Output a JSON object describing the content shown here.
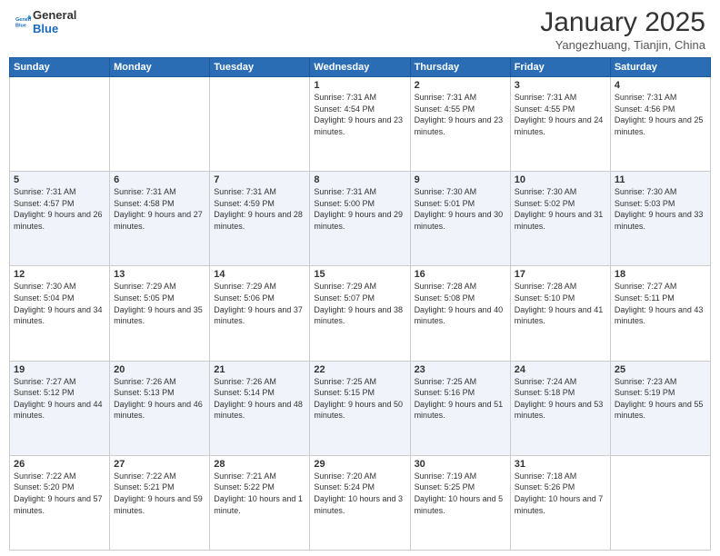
{
  "header": {
    "logo_line1": "General",
    "logo_line2": "Blue",
    "month_title": "January 2025",
    "location": "Yangezhuang, Tianjin, China"
  },
  "weekdays": [
    "Sunday",
    "Monday",
    "Tuesday",
    "Wednesday",
    "Thursday",
    "Friday",
    "Saturday"
  ],
  "weeks": [
    [
      {
        "day": "",
        "info": ""
      },
      {
        "day": "",
        "info": ""
      },
      {
        "day": "",
        "info": ""
      },
      {
        "day": "1",
        "info": "Sunrise: 7:31 AM\nSunset: 4:54 PM\nDaylight: 9 hours and 23 minutes."
      },
      {
        "day": "2",
        "info": "Sunrise: 7:31 AM\nSunset: 4:55 PM\nDaylight: 9 hours and 23 minutes."
      },
      {
        "day": "3",
        "info": "Sunrise: 7:31 AM\nSunset: 4:55 PM\nDaylight: 9 hours and 24 minutes."
      },
      {
        "day": "4",
        "info": "Sunrise: 7:31 AM\nSunset: 4:56 PM\nDaylight: 9 hours and 25 minutes."
      }
    ],
    [
      {
        "day": "5",
        "info": "Sunrise: 7:31 AM\nSunset: 4:57 PM\nDaylight: 9 hours and 26 minutes."
      },
      {
        "day": "6",
        "info": "Sunrise: 7:31 AM\nSunset: 4:58 PM\nDaylight: 9 hours and 27 minutes."
      },
      {
        "day": "7",
        "info": "Sunrise: 7:31 AM\nSunset: 4:59 PM\nDaylight: 9 hours and 28 minutes."
      },
      {
        "day": "8",
        "info": "Sunrise: 7:31 AM\nSunset: 5:00 PM\nDaylight: 9 hours and 29 minutes."
      },
      {
        "day": "9",
        "info": "Sunrise: 7:30 AM\nSunset: 5:01 PM\nDaylight: 9 hours and 30 minutes."
      },
      {
        "day": "10",
        "info": "Sunrise: 7:30 AM\nSunset: 5:02 PM\nDaylight: 9 hours and 31 minutes."
      },
      {
        "day": "11",
        "info": "Sunrise: 7:30 AM\nSunset: 5:03 PM\nDaylight: 9 hours and 33 minutes."
      }
    ],
    [
      {
        "day": "12",
        "info": "Sunrise: 7:30 AM\nSunset: 5:04 PM\nDaylight: 9 hours and 34 minutes."
      },
      {
        "day": "13",
        "info": "Sunrise: 7:29 AM\nSunset: 5:05 PM\nDaylight: 9 hours and 35 minutes."
      },
      {
        "day": "14",
        "info": "Sunrise: 7:29 AM\nSunset: 5:06 PM\nDaylight: 9 hours and 37 minutes."
      },
      {
        "day": "15",
        "info": "Sunrise: 7:29 AM\nSunset: 5:07 PM\nDaylight: 9 hours and 38 minutes."
      },
      {
        "day": "16",
        "info": "Sunrise: 7:28 AM\nSunset: 5:08 PM\nDaylight: 9 hours and 40 minutes."
      },
      {
        "day": "17",
        "info": "Sunrise: 7:28 AM\nSunset: 5:10 PM\nDaylight: 9 hours and 41 minutes."
      },
      {
        "day": "18",
        "info": "Sunrise: 7:27 AM\nSunset: 5:11 PM\nDaylight: 9 hours and 43 minutes."
      }
    ],
    [
      {
        "day": "19",
        "info": "Sunrise: 7:27 AM\nSunset: 5:12 PM\nDaylight: 9 hours and 44 minutes."
      },
      {
        "day": "20",
        "info": "Sunrise: 7:26 AM\nSunset: 5:13 PM\nDaylight: 9 hours and 46 minutes."
      },
      {
        "day": "21",
        "info": "Sunrise: 7:26 AM\nSunset: 5:14 PM\nDaylight: 9 hours and 48 minutes."
      },
      {
        "day": "22",
        "info": "Sunrise: 7:25 AM\nSunset: 5:15 PM\nDaylight: 9 hours and 50 minutes."
      },
      {
        "day": "23",
        "info": "Sunrise: 7:25 AM\nSunset: 5:16 PM\nDaylight: 9 hours and 51 minutes."
      },
      {
        "day": "24",
        "info": "Sunrise: 7:24 AM\nSunset: 5:18 PM\nDaylight: 9 hours and 53 minutes."
      },
      {
        "day": "25",
        "info": "Sunrise: 7:23 AM\nSunset: 5:19 PM\nDaylight: 9 hours and 55 minutes."
      }
    ],
    [
      {
        "day": "26",
        "info": "Sunrise: 7:22 AM\nSunset: 5:20 PM\nDaylight: 9 hours and 57 minutes."
      },
      {
        "day": "27",
        "info": "Sunrise: 7:22 AM\nSunset: 5:21 PM\nDaylight: 9 hours and 59 minutes."
      },
      {
        "day": "28",
        "info": "Sunrise: 7:21 AM\nSunset: 5:22 PM\nDaylight: 10 hours and 1 minute."
      },
      {
        "day": "29",
        "info": "Sunrise: 7:20 AM\nSunset: 5:24 PM\nDaylight: 10 hours and 3 minutes."
      },
      {
        "day": "30",
        "info": "Sunrise: 7:19 AM\nSunset: 5:25 PM\nDaylight: 10 hours and 5 minutes."
      },
      {
        "day": "31",
        "info": "Sunrise: 7:18 AM\nSunset: 5:26 PM\nDaylight: 10 hours and 7 minutes."
      },
      {
        "day": "",
        "info": ""
      }
    ]
  ]
}
